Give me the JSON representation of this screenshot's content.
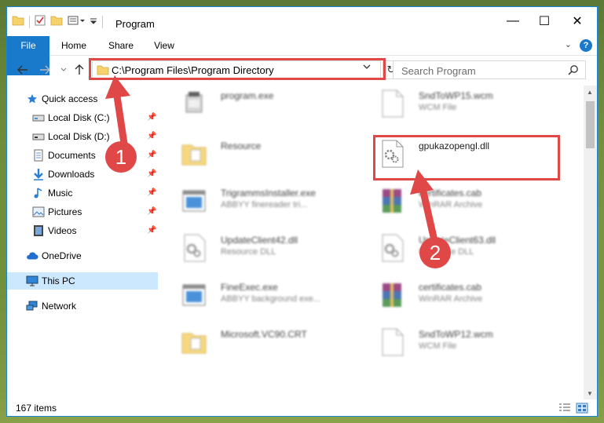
{
  "window": {
    "title": "Program",
    "controls": {
      "minimize": "—",
      "maximize": "☐",
      "close": "✕"
    }
  },
  "ribbon": {
    "tabs": [
      "File",
      "Home",
      "Share",
      "View"
    ],
    "help": "?"
  },
  "address": {
    "path": "C:\\Program Files\\Program Directory",
    "search_placeholder": "Search Program"
  },
  "nav": {
    "items": [
      {
        "label": "Quick access",
        "icon": "star-icon"
      },
      {
        "label": "Local Disk (C:)",
        "icon": "drive-icon",
        "pinned": true
      },
      {
        "label": "Local Disk (D:)",
        "icon": "drive-icon",
        "pinned": true
      },
      {
        "label": "Documents",
        "icon": "documents-icon",
        "pinned": true
      },
      {
        "label": "Downloads",
        "icon": "downloads-icon",
        "pinned": true
      },
      {
        "label": "Music",
        "icon": "music-icon",
        "pinned": true
      },
      {
        "label": "Pictures",
        "icon": "pictures-icon",
        "pinned": true
      },
      {
        "label": "Videos",
        "icon": "videos-icon",
        "pinned": true
      },
      {
        "label": "OneDrive",
        "icon": "cloud-icon"
      },
      {
        "label": "This PC",
        "icon": "computer-icon",
        "selected": true
      },
      {
        "label": "Network",
        "icon": "network-icon"
      }
    ]
  },
  "files": [
    {
      "name": "program.exe",
      "type": "",
      "icon": "exe-icon"
    },
    {
      "name": "SndToWP15.wcm",
      "type": "WCM File",
      "icon": "blank-file-icon"
    },
    {
      "name": "Resource",
      "type": "",
      "icon": "folder-icon"
    },
    {
      "name": "gpukazopengl.dll",
      "type": "",
      "icon": "dll-gear-icon",
      "highlighted": true
    },
    {
      "name": "TrigrammsInstaller.exe",
      "type": "ABBYY finereader tri...",
      "icon": "app-window-icon"
    },
    {
      "name": "certificates.cab",
      "type": "WinRAR Archive",
      "icon": "winrar-icon"
    },
    {
      "name": "UpdateClient42.dll",
      "type": "Resource DLL",
      "icon": "dll-gear-icon"
    },
    {
      "name": "UpdateClient63.dll",
      "type": "Resource DLL",
      "icon": "dll-gear-icon"
    },
    {
      "name": "FineExec.exe",
      "type": "ABBYY background exe...",
      "icon": "app-window-icon"
    },
    {
      "name": "certificates.cab",
      "type": "WinRAR Archive",
      "icon": "winrar-icon"
    },
    {
      "name": "Microsoft.VC90.CRT",
      "type": "",
      "icon": "folder-icon"
    },
    {
      "name": "SndToWP12.wcm",
      "type": "WCM File",
      "icon": "blank-file-icon"
    }
  ],
  "status": {
    "count": "167 items"
  },
  "annotations": [
    {
      "label": "1"
    },
    {
      "label": "2"
    }
  ],
  "colors": {
    "accent": "#1979ca",
    "highlight": "#e04848",
    "selected": "#cce8ff"
  }
}
